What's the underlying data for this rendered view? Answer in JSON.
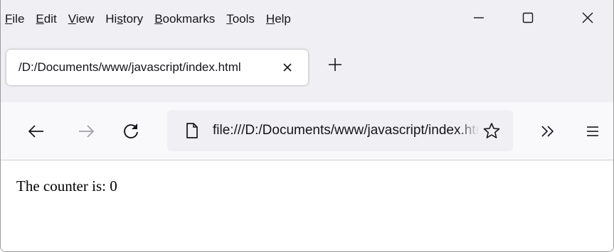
{
  "menubar": {
    "items": [
      {
        "before": "",
        "accel": "F",
        "after": "ile"
      },
      {
        "before": "",
        "accel": "E",
        "after": "dit"
      },
      {
        "before": "",
        "accel": "V",
        "after": "iew"
      },
      {
        "before": "Hi",
        "accel": "s",
        "after": "tory"
      },
      {
        "before": "",
        "accel": "B",
        "after": "ookmarks"
      },
      {
        "before": "",
        "accel": "T",
        "after": "ools"
      },
      {
        "before": "",
        "accel": "H",
        "after": "elp"
      }
    ]
  },
  "window_controls": {
    "minimize_icon": "minimize-icon",
    "maximize_icon": "maximize-icon",
    "close_icon": "close-icon"
  },
  "tab": {
    "title": "/D:/Documents/www/javascript/index.html",
    "close_icon": "close-icon"
  },
  "new_tab_icon": "plus-icon",
  "navbar": {
    "back_icon": "back-arrow-icon",
    "forward_icon": "forward-arrow-icon",
    "reload_icon": "reload-icon",
    "url": "file:///D:/Documents/www/javascript/index.html",
    "page_icon": "page-icon",
    "bookmark_icon": "star-icon",
    "overflow_icon": "double-chevron-icon",
    "menu_icon": "hamburger-icon"
  },
  "content": {
    "counter_text": "The counter is: 0"
  },
  "colors": {
    "chrome": "#f0f0f4",
    "navbar": "#f9f9fb",
    "text": "#15141a"
  }
}
